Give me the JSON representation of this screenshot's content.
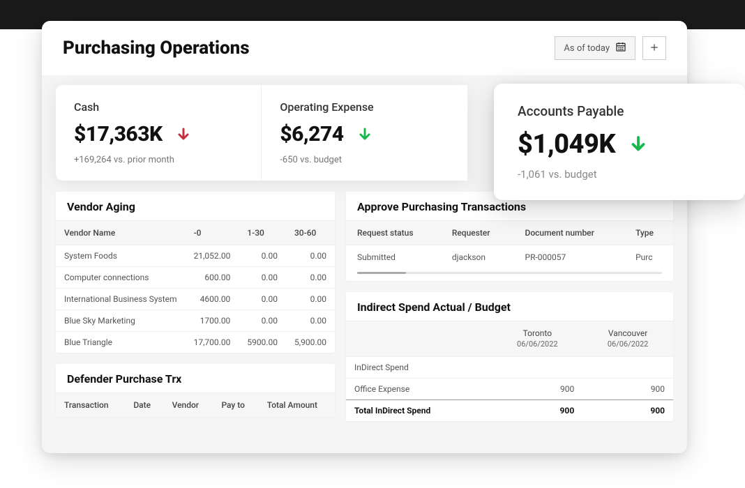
{
  "header": {
    "title": "Purchasing Operations",
    "as_of_label": "As of today"
  },
  "kpis": {
    "cash": {
      "title": "Cash",
      "value": "$17,363K",
      "delta": "+169,264 vs. prior month"
    },
    "opex": {
      "title": "Operating Expense",
      "value": "$6,274",
      "delta": "-650 vs. budget"
    },
    "ap_placeholder": {
      "title": "",
      "value": "",
      "delta": ""
    }
  },
  "floating": {
    "title": "Accounts Payable",
    "value": "$1,049K",
    "delta": "-1,061 vs. budget"
  },
  "vendor_aging": {
    "title": "Vendor Aging",
    "cols": {
      "c0": "Vendor Name",
      "c1": "-0",
      "c2": "1-30",
      "c3": "30-60"
    },
    "rows": [
      {
        "name": "System Foods",
        "a": "21,052.00",
        "b": "0.00",
        "c": "0.00"
      },
      {
        "name": "Computer connections",
        "a": "600.00",
        "b": "0.00",
        "c": "0.00"
      },
      {
        "name": "International Business System",
        "a": "4600.00",
        "b": "0.00",
        "c": "0.00"
      },
      {
        "name": "Blue Sky Marketing",
        "a": "1700.00",
        "b": "0.00",
        "c": "0.00"
      },
      {
        "name": "Blue Triangle",
        "a": "17,700.00",
        "b": "5900.00",
        "c": "5,900.00"
      }
    ]
  },
  "defender": {
    "title": "Defender Purchase Trx",
    "cols": {
      "c0": "Transaction",
      "c1": "Date",
      "c2": "Vendor",
      "c3": "Pay to",
      "c4": "Total Amount"
    }
  },
  "approve": {
    "title": "Approve Purchasing Transactions",
    "cols": {
      "c0": "Request status",
      "c1": "Requester",
      "c2": "Document number",
      "c3": "Type"
    },
    "row": {
      "status": "Submitted",
      "requester": "djackson",
      "doc": "PR-000057",
      "type": "Purc"
    }
  },
  "spend": {
    "title": "Indirect Spend Actual / Budget",
    "loc1": "Toronto",
    "date1": "06/06/2022",
    "loc2": "Vancouver",
    "date2": "06/06/2022",
    "cat_label": "InDirect Spend",
    "row1_label": "Office Expense",
    "row1_a": "900",
    "row1_b": "900",
    "total_label": "Total InDirect Spend",
    "total_a": "900",
    "total_b": "900"
  }
}
